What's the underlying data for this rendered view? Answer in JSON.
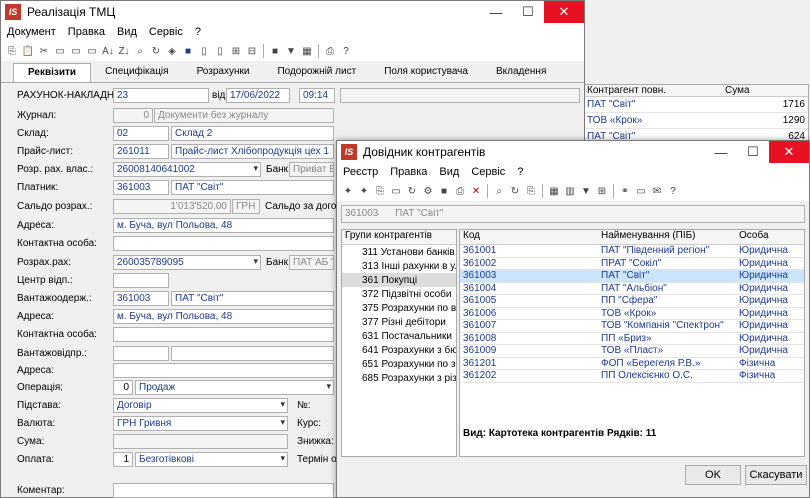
{
  "main": {
    "title": "Реалізація ТМЦ",
    "menu": [
      "Документ",
      "Правка",
      "Вид",
      "Сервіс",
      "?"
    ],
    "tabs": [
      "Реквізити",
      "Специфікація",
      "Розрахунки",
      "Подорожній лист",
      "Поля користувача",
      "Вкладення"
    ],
    "doc_label": "РАХУНОК-НАКЛАДНА №:",
    "doc_num": "23",
    "date_label": "від:",
    "date": "17/06/2022",
    "time": "09:14",
    "journal_label": "Журнал:",
    "journal_code": "0",
    "journal_name": "Документи без журналу",
    "warehouse_label": "Склад:",
    "warehouse_code": "02",
    "warehouse_name": "Склад 2",
    "pricelist_label": "Прайс-лист:",
    "pricelist_code": "261011",
    "pricelist_name": "Прайс-лист Хлібопродукція цех 1",
    "account_label": "Розр. рах. влас.:",
    "account": "26008140641002",
    "bank_label": "Банк:",
    "bank": "Приват Б",
    "payer_label": "Платник:",
    "payer_code": "361003",
    "payer_name": "ПАТ \"Світ\"",
    "saldo_label": "Сальдо розрах.:",
    "saldo": "1'013'520.00",
    "currency": "ГРН",
    "saldo_contract": "Сальдо за догово",
    "address_label": "Адреса:",
    "address": "м. Буча, вул Польова, 48",
    "contact_label": "Контактна особа:",
    "payacc_label": "Розрах.рах:",
    "payacc": "260035789095",
    "bank2": "ПАТ АБ \"У",
    "center_label": "Центр відп.:",
    "consignee_label": "Вантажоодерж.:",
    "consignee_code": "361003",
    "consignee_name": "ПАТ \"Світ\"",
    "address2_label": "Адреса:",
    "address2": "м. Буча, вул Польова, 48",
    "contact2_label": "Контактна особа:",
    "shipper_label": "Вантажовідпр.:",
    "address3_label": "Адреса:",
    "operation_label": "Операція:",
    "operation_code": "0",
    "operation": "Продаж",
    "basis_label": "Підстава:",
    "basis": "Договір",
    "no_label": "№:",
    "curr_label": "Валюта:",
    "curr": "ГРН Гривня",
    "rate_label": "Курс:",
    "sum_label": "Сума:",
    "discount_label": "Знижка:",
    "payment_label": "Оплата:",
    "payment_code": "1",
    "payment": "Безготівкові",
    "term_label": "Термін оп",
    "comment_label": "Коментар:"
  },
  "bg_table": {
    "headers": [
      "Контрагент повн.",
      "Сума"
    ],
    "rows": [
      [
        "ПАТ \"Світ\"",
        "1716"
      ],
      [
        "ТОВ «Крок»",
        "1290"
      ],
      [
        "ПАТ \"Світ\"",
        "624"
      ]
    ]
  },
  "dialog": {
    "title": "Довідник контрагентів",
    "menu": [
      "Реєстр",
      "Правка",
      "Вид",
      "Сервіс",
      "?"
    ],
    "filter_code": "361003",
    "filter_name": "ПАТ \"Світ\"",
    "groups_header": "Групи контрагентів",
    "groups": [
      "311 Установи банків",
      "313 Інші рахунки в у...",
      "361 Покупці",
      "372 Підзвітні особи",
      "375 Розрахунки по ві...",
      "377 Різні дебітори",
      "631 Постачальники",
      "641 Розрахунки з бю...",
      "651 Розрахунки по з...",
      "685 Розрахунки з різ..."
    ],
    "col_code": "Код",
    "col_name": "Найменування (ПІБ)",
    "col_person": "Особа",
    "rows": [
      [
        "361001",
        "ПАТ \"Південний регіон\"",
        "Юридична"
      ],
      [
        "361002",
        "ПРАТ \"Сокіл\"",
        "Юридична"
      ],
      [
        "361003",
        "ПАТ \"Світ\"",
        "Юридична"
      ],
      [
        "361004",
        "ПАТ \"Альбіон\"",
        "Юридична"
      ],
      [
        "361005",
        "ПП \"Сфера\"",
        "Юридична"
      ],
      [
        "361006",
        "ТОВ «Крок»",
        "Юридична"
      ],
      [
        "361007",
        "ТОВ \"Компанія \"Спектрон\"",
        "Юридична"
      ],
      [
        "361008",
        "ПП «Бриз»",
        "Юридична"
      ],
      [
        "361009",
        "ТОВ «Пласт»",
        "Юридична"
      ],
      [
        "361201",
        "ФОП «Берегеля Р.В.»",
        "Фізична"
      ],
      [
        "361202",
        "ПП Олексієнко О.С.",
        "Фізична"
      ]
    ],
    "status_view": "Вид: Картотека контрагентів",
    "status_rows": "Рядків: 11",
    "ok": "OK",
    "cancel": "Скасувати"
  }
}
